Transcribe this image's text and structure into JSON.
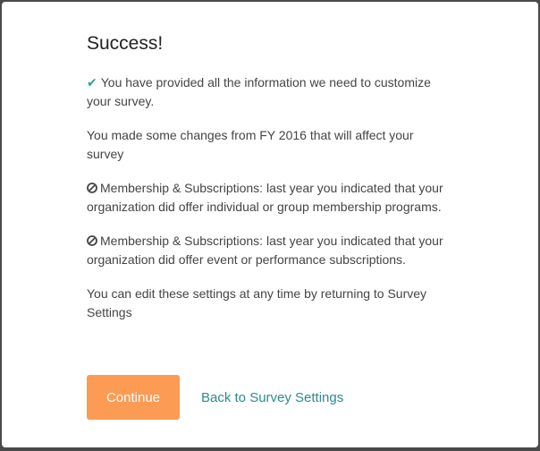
{
  "modal": {
    "title": "Success!",
    "confirmation": "You have provided all the information we need to customize your survey.",
    "changes_intro": "You made some changes from FY 2016 that will affect your survey",
    "notices": [
      "Membership & Subscriptions: last year you indicated that your organization did offer individual or group membership programs.",
      "Membership & Subscriptions: last year you indicated that your organization did offer event or performance subscriptions."
    ],
    "edit_note": "You can edit these settings at any time by returning to Survey Settings",
    "continue_label": "Continue",
    "back_label": "Back to Survey Settings"
  },
  "icons": {
    "confirmation": "checkmark-icon",
    "notice": "disabled-circle-icon"
  },
  "colors": {
    "accent_button": "#fb9b54",
    "link": "#2a8c8c",
    "check": "#2aa198"
  }
}
